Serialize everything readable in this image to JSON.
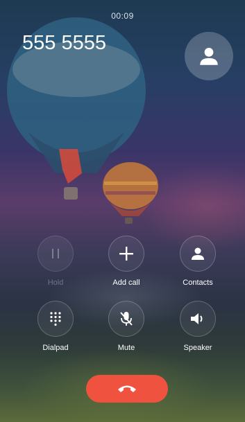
{
  "call": {
    "timer": "00:09",
    "number": "555 5555"
  },
  "icons": {
    "avatar": "person-icon",
    "hold": "pause-icon",
    "add_call": "plus-icon",
    "contacts": "person-icon",
    "dialpad": "dialpad-icon",
    "mute": "mic-off-icon",
    "speaker": "speaker-icon",
    "end": "phone-hangup-icon"
  },
  "controls": {
    "hold": {
      "label": "Hold",
      "enabled": false
    },
    "add_call": {
      "label": "Add call",
      "enabled": true
    },
    "contacts": {
      "label": "Contacts",
      "enabled": true
    },
    "dialpad": {
      "label": "Dialpad",
      "enabled": true
    },
    "mute": {
      "label": "Mute",
      "enabled": true
    },
    "speaker": {
      "label": "Speaker",
      "enabled": true
    }
  },
  "colors": {
    "end_call": "#ef5340"
  }
}
